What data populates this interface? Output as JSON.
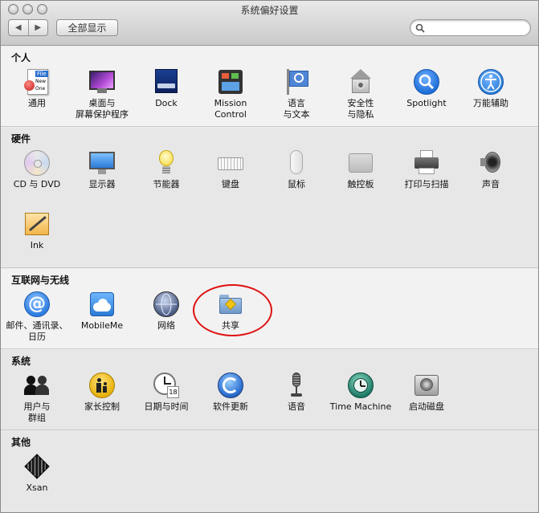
{
  "window": {
    "title": "系统偏好设置"
  },
  "toolbar": {
    "back_label": "◀",
    "forward_label": "▶",
    "show_all_label": "全部显示",
    "search_value": ""
  },
  "sections": [
    {
      "title": "个人",
      "items": [
        {
          "label": "通用",
          "icon": "general-icon"
        },
        {
          "label": "桌面与\n屏幕保护程序",
          "icon": "desktop-screensaver-icon"
        },
        {
          "label": "Dock",
          "icon": "dock-icon"
        },
        {
          "label": "Mission\nControl",
          "icon": "mission-control-icon"
        },
        {
          "label": "语言\n与文本",
          "icon": "language-text-icon"
        },
        {
          "label": "安全性\n与隐私",
          "icon": "security-privacy-icon"
        },
        {
          "label": "Spotlight",
          "icon": "spotlight-icon"
        },
        {
          "label": "万能辅助",
          "icon": "universal-access-icon"
        }
      ]
    },
    {
      "title": "硬件",
      "items": [
        {
          "label": "CD 与 DVD",
          "icon": "cd-dvd-icon"
        },
        {
          "label": "显示器",
          "icon": "displays-icon"
        },
        {
          "label": "节能器",
          "icon": "energy-saver-icon"
        },
        {
          "label": "键盘",
          "icon": "keyboard-icon"
        },
        {
          "label": "鼠标",
          "icon": "mouse-icon"
        },
        {
          "label": "触控板",
          "icon": "trackpad-icon"
        },
        {
          "label": "打印与扫描",
          "icon": "print-scan-icon"
        },
        {
          "label": "声音",
          "icon": "sound-icon"
        },
        {
          "label": "Ink",
          "icon": "ink-icon"
        }
      ]
    },
    {
      "title": "互联网与无线",
      "items": [
        {
          "label": "邮件、通讯录、\n日历",
          "icon": "mail-contacts-calendars-icon"
        },
        {
          "label": "MobileMe",
          "icon": "mobileme-icon"
        },
        {
          "label": "网络",
          "icon": "network-icon"
        },
        {
          "label": "共享",
          "icon": "sharing-icon"
        }
      ]
    },
    {
      "title": "系统",
      "items": [
        {
          "label": "用户与\n群组",
          "icon": "users-groups-icon"
        },
        {
          "label": "家长控制",
          "icon": "parental-controls-icon"
        },
        {
          "label": "日期与时间",
          "icon": "date-time-icon"
        },
        {
          "label": "软件更新",
          "icon": "software-update-icon"
        },
        {
          "label": "语音",
          "icon": "speech-icon"
        },
        {
          "label": "Time Machine",
          "icon": "time-machine-icon"
        },
        {
          "label": "启动磁盘",
          "icon": "startup-disk-icon"
        }
      ]
    },
    {
      "title": "其他",
      "items": [
        {
          "label": "Xsan",
          "icon": "xsan-icon"
        }
      ]
    }
  ],
  "icon_text": {
    "general_file": "File",
    "general_new": "New",
    "general_one": "One",
    "calendar_day": "18"
  },
  "colors": {
    "annotation": "#e01010",
    "spotlight": "#1e6fd9",
    "universal_access": "#2a7fd8",
    "mail": "#2f7de0"
  }
}
